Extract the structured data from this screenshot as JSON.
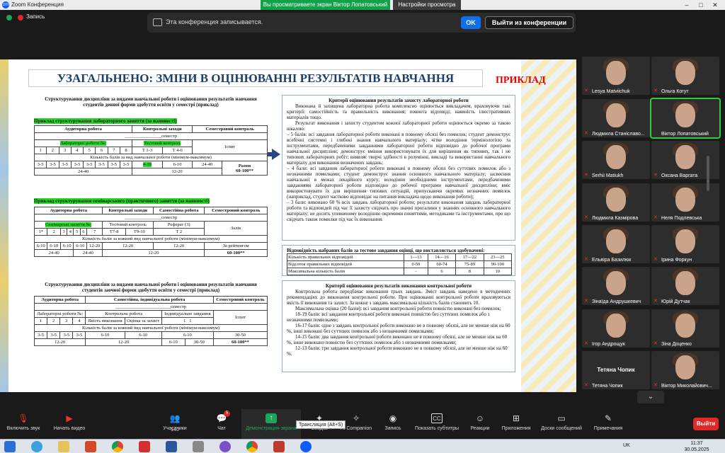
{
  "window": {
    "app_title": "Zoom Конференция",
    "app_icon": "zm"
  },
  "banner": {
    "sharing": "Вы просматриваете экран Віктор Лопатовський",
    "view_options": "Настройки просмотра",
    "controls": [
      "–",
      "□",
      "✕"
    ]
  },
  "recording": {
    "label": "Запись",
    "message": "Эта конференция записывается.",
    "ok": "OK",
    "leave": "Выйти из конференции"
  },
  "slide": {
    "title": "УЗАГАЛЬНЕНО: ЗМІНИ В ОЦІНЮВАННІ РЕЗУЛЬТАТІВ НАВЧАННЯ",
    "example": "ПРИКЛАД",
    "left": {
      "heading1": "Структурування дисципліни за видами навчальної роботи і оцінювання результатів навчання студентів денної форми здобуття освіти у семестрі (приклад)",
      "sub1": "Приклад структурування лабораторного заняття (за наявності)",
      "t1": {
        "h1": "Аудиторна робота",
        "h2": "Контрольні заходи",
        "h3": "Семестровий контроль",
        "sem": "________________семестр",
        "lab": "Лабораторні роботи №:",
        "tests": "Тестовий контроль",
        "credit": "Іспит",
        "nums": [
          "1",
          "2",
          "3",
          "4",
          "5",
          "6",
          "7",
          "8",
          "Т 1-3",
          "Т 4-6"
        ],
        "dist": "Кількість балів за вид навчальної роботи (мінімум-максимум)",
        "scores": [
          "3-5",
          "3-5",
          "3-5",
          "3-5",
          "3-5",
          "3-5",
          "3-5",
          "3-5",
          "4-10",
          "6-10",
          "24-40"
        ],
        "sum1": "24-40",
        "sum2": "12-20",
        "total_label": "Разом",
        "total": "60-100**"
      },
      "sub2": "Приклад структурування семінарського (практичного) заняття (за наявності)",
      "t2": {
        "h1": "Аудиторна робота",
        "h2": "Контрольні заходи",
        "h3": "Самостійна робота",
        "h4": "Семестровий контроль",
        "sem": "________________семестр",
        "sem_lesson": "Семінарські заняття №:",
        "test": "Тестовий контроль",
        "report": "Реферат (3)",
        "credit": "Залік",
        "nums": [
          "1*",
          "2",
          "3",
          "4",
          "5",
          "6",
          "7",
          "Т7-8",
          "Т9-10",
          "Т 2"
        ],
        "dist": "Кількість балів за кожний вид навчальної роботи (мінімум-максимум)",
        "scores": [
          "6-10",
          "6-10",
          "6-10",
          "6-10",
          "12-20",
          "12-20",
          "12-20"
        ],
        "sum1": "24-40",
        "sum2": "24-40",
        "sum3": "12-20",
        "rating_label": "За рейтингом",
        "total": "60-100**"
      },
      "heading2": "Структурування дисципліни за видами навчальної роботи і оцінювання результатів навчання студентів заочної форми здобуття освіти у семестрі (приклад)",
      "t3": {
        "h1": "Аудиторна робота",
        "h2": "Самостійна, індивідуальна робота",
        "h3": "Семестровий контроль",
        "sem": "________________________семестр",
        "lab": "Лабораторні роботи №:",
        "control": "Контрольна робота",
        "indiv": "Індивідуальне завдання",
        "exam": "Іспит",
        "nums": [
          "1",
          "2",
          "3",
          "4"
        ],
        "quality": "Якість виконання",
        "defense": "Оцінка за захист",
        "one": "1",
        "one2": "1",
        "dist": "Кількість балів за кожний вид навчальної роботи (мінімум-максимум)",
        "scores": [
          "3-5",
          "3-5",
          "3-5",
          "3-5",
          "6-10",
          "6-10",
          "6-10",
          "30-50"
        ],
        "sum1": "12-20",
        "sum2": "12-20",
        "sum3": "6-10",
        "sum4": "30-50",
        "total": "60-100**"
      }
    },
    "right": {
      "c1_title": "Критерії оцінювання результатів захисту лабораторної роботи",
      "c1_lines": [
        "Виконана й захищена лабораторна робота комплексно оцінюється викладачем, враховуючи такі критерії: самостійність та правильність виконання; повнота відповіді; наявність ілюстративних матеріалів тощо.",
        "Результат виконання і захисту студентом кожної лабораторної роботи оцінюється окремо за такою шкалою:",
        "– 5 балів: всі завдання лабораторної роботи виконані в повному обсязі без помилок; студент демонструє всебічні системні і глибокі знання навчального матеріалу; чітке володіння термінологією та інструментами, передбаченими завданнями лабораторної роботи відповідно до робочої програми навчальної дисципліни; демонструє вміння використовувати їх для вирішення як типових, так і не типових лабораторних робіт; виявляє творчі здібності в розумінні, викладі та використанні навчального матеріалу для виконання визначених завдань;",
        "– 4 бали: всі завдання лабораторної роботи виконані в повному обсязі без суттєвих помилок або з незначними помилками; студент демонструє знання основного навчального матеріалу; засвоєння навчальної в межах лекційного курсу; володіння необхідними інструментами, передбаченими завданнями лабораторної роботи відповідно до робочої програми навчальної дисципліни; вміє використовувати їх для вирішення типових ситуацій, припускаючи окремих незначних помилок (наприклад, студент частково відповідає на питання викладача щодо виконання роботи);",
        "– 3 бали: виконано 60 % всіх завдань лабораторної роботи; результати виконання завдань лабораторної роботи та відповідей під час її захисту свідчать про значні прогалини у знаннях основного навчального матеріалу; не досить упевненому володінню окремими поняттями, методиками та інструментами, про що свідчать також помилки під час їх виконання."
      ],
      "t4_title": "Відповідність набраних балів за тестове завдання оцінці, що виставляється здобувачеві:",
      "t4_rows": [
        [
          "Кількість правильних відповідей",
          "1—13",
          "14—16",
          "17—22",
          "23—25"
        ],
        [
          "Відсоток правильних відповідей",
          "0-59",
          "60-74",
          "75-89",
          "90-100"
        ],
        [
          "Максимальна кількість балів",
          "-",
          "6",
          "8",
          "10"
        ]
      ],
      "c2_title": "Критерії оцінювання результатів виконання контрольної роботи",
      "c2_lines": [
        "Контрольна робота передбачає виконання трьох завдань. Зміст завдань наведено в методичних рекомендаціях до виконання контрольної роботи. При оцінюванні контрольної роботи враховуються якість її виконання та захист. За кожне з завдань максимальна кількість балів становить 10.",
        "Максимальна оцінка (20 балів): всі завдання контрольної роботи повністю виконані без помилок;",
        "18-19 балів: всі завдання контрольної роботи виконані повністю без суттєвих помилок або з незначними помилками;",
        "16-17 балів: одне з завдань контрольної роботи виконано не в повному обсязі, але не менше ніж на 60 %, інші виконані без суттєвих помилок або з незначними помилками;",
        "14-15 балів: два завдання контрольної роботи виконано не в повному обсязі, але не менше ніж на 60 %, інше виконано повністю без суттєвих помилок або з незначними помилками;",
        "12-13 балів: три завдання контрольної роботи виконано не в повному обсязі, але не менше ніж на 60 %."
      ]
    }
  },
  "participants": [
    {
      "name": "Lesya Matviichuk",
      "muted": true
    },
    {
      "name": "Ольга Когут",
      "muted": true
    },
    {
      "name": "Людмила Станіславо...",
      "muted": true
    },
    {
      "name": "Віктор Лопатовський",
      "muted": false,
      "active": true
    },
    {
      "name": "Serhii Matiukh",
      "muted": true
    },
    {
      "name": "Оксана Варгата",
      "muted": true
    },
    {
      "name": "Людмила Казмірова",
      "muted": true
    },
    {
      "name": "Неля Подлевська",
      "muted": true
    },
    {
      "name": "Ельвіра Базилюк",
      "muted": true
    },
    {
      "name": "Ірина Форкун",
      "muted": true
    },
    {
      "name": "Зінаїда Андрушкевич",
      "muted": true
    },
    {
      "name": "Юрій Дутчак",
      "muted": true
    },
    {
      "name": "Ігор Андрощук",
      "muted": true
    },
    {
      "name": "Зіна Доценко",
      "muted": true
    },
    {
      "name": "Тетяна Чопик",
      "muted": true,
      "big_label": "Тетяна Чопик"
    },
    {
      "name": "Віктор Миколайович...",
      "muted": true
    }
  ],
  "toolbar": {
    "mute": "Включить звук",
    "video": "Начать видео",
    "participants": "Участники",
    "participants_count": "140",
    "chat": "Чат",
    "chat_badge": "5",
    "share": "Демонстрация экрана",
    "summary": "Сводка",
    "ai": "AI Companion",
    "record": "Запись",
    "captions": "Показать субтитры",
    "reactions": "Реакции",
    "apps": "Приложения",
    "boards": "Доски сообщений",
    "notes": "Примечания",
    "end": "Выйти",
    "tooltip": "Трансляция (Alt+S)"
  },
  "taskbar": {
    "lang": "UK",
    "time": "11:37",
    "date": "30.05.2025"
  }
}
